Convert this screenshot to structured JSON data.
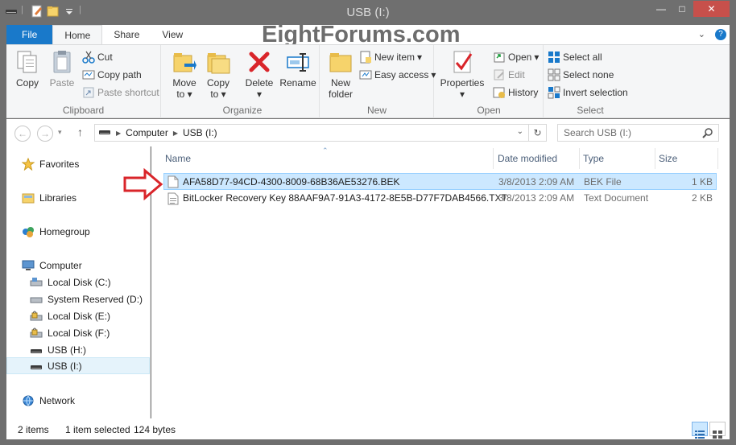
{
  "window": {
    "title": "USB (I:)",
    "min": "—",
    "max": "□",
    "close": "✕"
  },
  "watermark": "EightForums.com",
  "tabs": [
    {
      "label": "File"
    },
    {
      "label": "Home"
    },
    {
      "label": "Share"
    },
    {
      "label": "View"
    }
  ],
  "ribbon": {
    "clipboard": {
      "label": "Clipboard",
      "copy": "Copy",
      "paste": "Paste",
      "cut": "Cut",
      "copy_path": "Copy path",
      "paste_shortcut": "Paste shortcut"
    },
    "organize": {
      "label": "Organize",
      "move_to": "Move",
      "move_to2": "to",
      "copy_to": "Copy",
      "copy_to2": "to",
      "delete": "Delete",
      "rename": "Rename"
    },
    "new": {
      "label": "New",
      "new_folder": "New",
      "new_folder2": "folder",
      "new_item": "New item",
      "easy_access": "Easy access"
    },
    "open": {
      "label": "Open",
      "properties": "Properties",
      "open": "Open",
      "edit": "Edit",
      "history": "History"
    },
    "select": {
      "label": "Select",
      "select_all": "Select all",
      "select_none": "Select none",
      "invert": "Invert selection"
    }
  },
  "address": {
    "crumbs": [
      "Computer",
      "USB (I:)"
    ],
    "search_placeholder": "Search USB (I:)"
  },
  "nav": {
    "favorites": "Favorites",
    "libraries": "Libraries",
    "homegroup": "Homegroup",
    "computer": "Computer",
    "drives": [
      "Local Disk (C:)",
      "System Reserved (D:)",
      "Local Disk (E:)",
      "Local Disk (F:)",
      "USB (H:)",
      "USB (I:)"
    ],
    "network": "Network"
  },
  "columns": {
    "name": "Name",
    "date": "Date modified",
    "type": "Type",
    "size": "Size"
  },
  "files": [
    {
      "name": "AFA58D77-94CD-4300-8009-68B36AE53276.BEK",
      "date": "3/8/2013 2:09 AM",
      "type": "BEK File",
      "size": "1 KB"
    },
    {
      "name": "BitLocker Recovery Key 88AAF9A7-91A3-4172-8E5B-D77F7DAB4566.TXT",
      "date": "3/8/2013 2:09 AM",
      "type": "Text Document",
      "size": "2 KB"
    }
  ],
  "status": {
    "items": "2 items",
    "selected": "1 item selected",
    "bytes": "124 bytes"
  },
  "colors": {
    "accent": "#1979ca",
    "selection": "#cce8ff",
    "arrow": "#d9252a",
    "chrome": "#6f6f6f"
  }
}
